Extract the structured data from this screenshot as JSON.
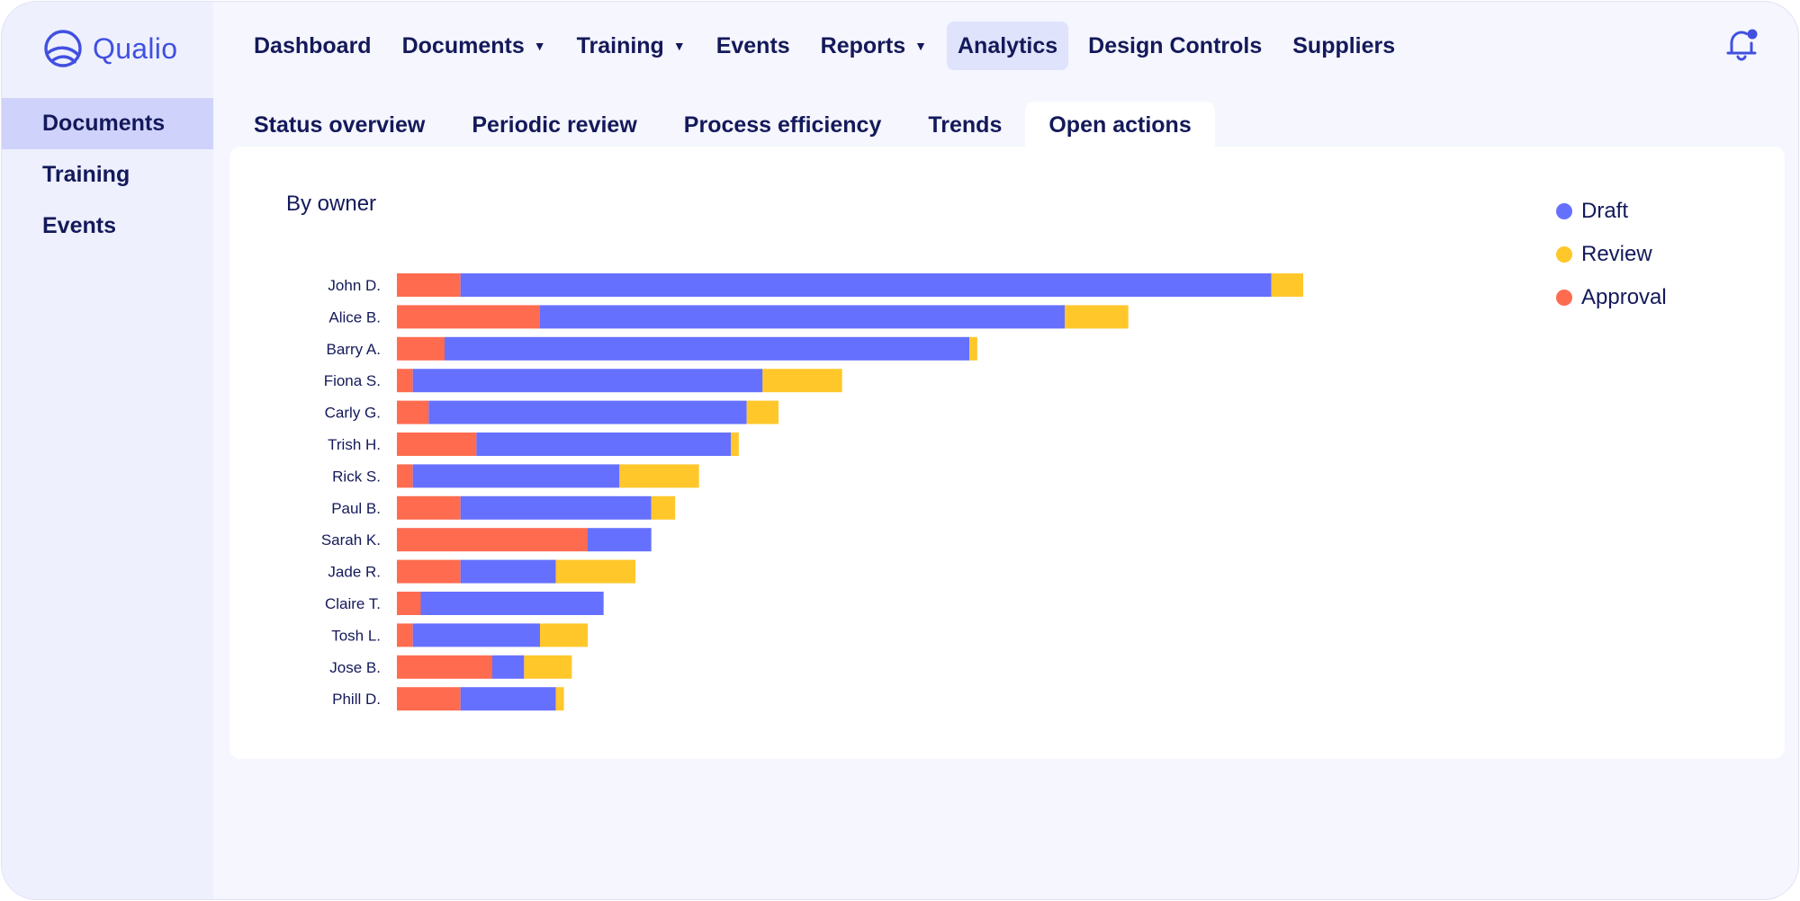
{
  "app": {
    "name": "Qualio"
  },
  "topnav": [
    {
      "label": "Dashboard",
      "caret": false,
      "active": false
    },
    {
      "label": "Documents",
      "caret": true,
      "active": false
    },
    {
      "label": "Training",
      "caret": true,
      "active": false
    },
    {
      "label": "Events",
      "caret": false,
      "active": false
    },
    {
      "label": "Reports",
      "caret": true,
      "active": false
    },
    {
      "label": "Analytics",
      "caret": false,
      "active": true
    },
    {
      "label": "Design Controls",
      "caret": false,
      "active": false
    },
    {
      "label": "Suppliers",
      "caret": false,
      "active": false
    }
  ],
  "sidebar": {
    "items": [
      {
        "label": "Documents",
        "active": true
      },
      {
        "label": "Training",
        "active": false
      },
      {
        "label": "Events",
        "active": false
      }
    ]
  },
  "tabs": [
    {
      "label": "Status overview",
      "active": false
    },
    {
      "label": "Periodic review",
      "active": false
    },
    {
      "label": "Process efficiency",
      "active": false
    },
    {
      "label": "Trends",
      "active": false
    },
    {
      "label": "Open actions",
      "active": true
    }
  ],
  "colors": {
    "accent": "#4150e0",
    "draft": "#6670ff",
    "review": "#ffc72a",
    "approval": "#ff6b4f"
  },
  "icons": {
    "logo": "qualio-logo-icon",
    "bell": "bell-notification-icon"
  },
  "chart_data": {
    "type": "bar",
    "orientation": "horizontal",
    "stacked": true,
    "title": "By owner",
    "legend_position": "top-right",
    "grid": false,
    "categories": [
      "John D.",
      "Alice B.",
      "Barry A.",
      "Fiona S.",
      "Carly G.",
      "Trish H.",
      "Rick S.",
      "Paul B.",
      "Sarah K.",
      "Jade R.",
      "Claire T.",
      "Tosh L.",
      "Jose B.",
      "Phill D."
    ],
    "series": [
      {
        "name": "Approval",
        "color": "#ff6b4f",
        "values": [
          8,
          18,
          6,
          2,
          4,
          10,
          2,
          8,
          24,
          8,
          3,
          2,
          12,
          8
        ]
      },
      {
        "name": "Draft",
        "color": "#6670ff",
        "values": [
          102,
          66,
          66,
          44,
          40,
          32,
          26,
          24,
          8,
          12,
          23,
          16,
          4,
          12
        ]
      },
      {
        "name": "Review",
        "color": "#ffc72a",
        "values": [
          4,
          8,
          1,
          10,
          4,
          1,
          10,
          3,
          0,
          10,
          0,
          6,
          6,
          1
        ]
      }
    ],
    "legend_order": [
      "Draft",
      "Review",
      "Approval"
    ],
    "xlim": [
      0,
      114
    ]
  }
}
